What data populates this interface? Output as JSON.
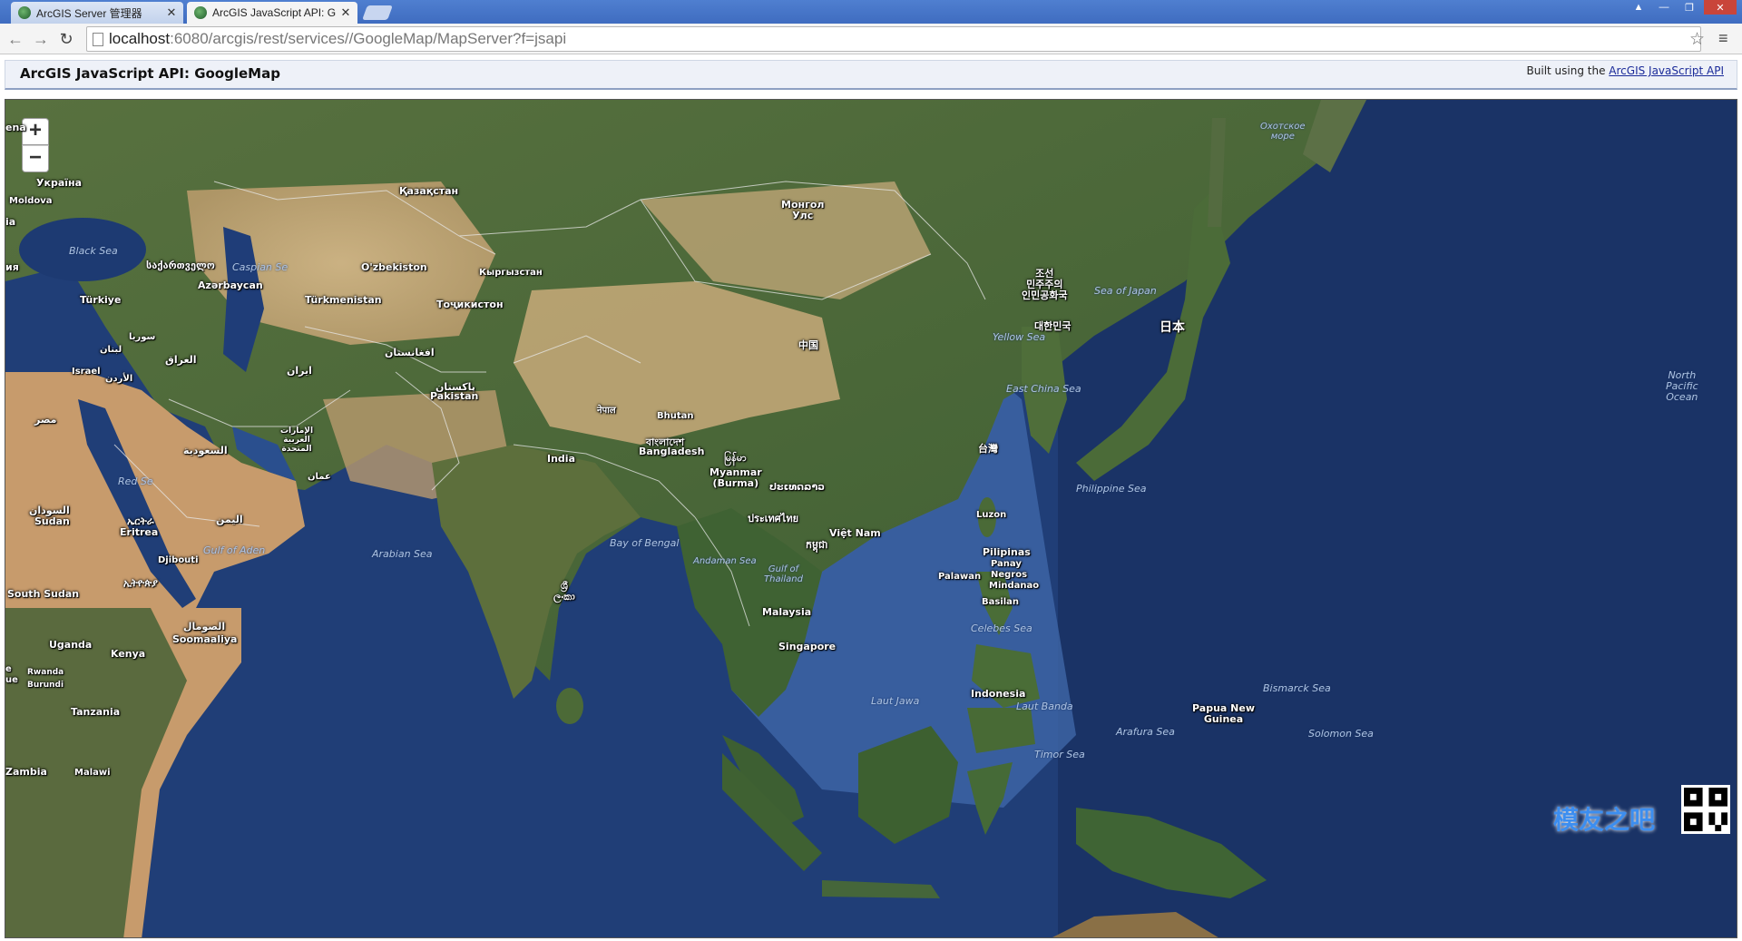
{
  "browser": {
    "tabs": [
      {
        "title": "ArcGIS Server 管理器",
        "active": false
      },
      {
        "title": "ArcGIS JavaScript API: G",
        "active": true
      }
    ],
    "address": {
      "host": "localhost",
      "path": ":6080/arcgis/rest/services//GoogleMap/MapServer?f=jsapi"
    },
    "window_controls": [
      "▲",
      "—",
      "❐",
      "✕"
    ]
  },
  "page": {
    "title": "ArcGIS JavaScript API: GoogleMap",
    "built_prefix": "Built using the",
    "built_link": "ArcGIS JavaScript API"
  },
  "map": {
    "zoom_in": "+",
    "zoom_out": "−",
    "labels": {
      "l_ena": "ena",
      "l_ukraina": "Україна",
      "l_moldova": "Moldova",
      "l_ia": "ia",
      "l_black_sea": "Black Sea",
      "l_sakartvelo": "საქართველო",
      "l_caspian": "Caspian Se",
      "l_azerbaycan": "Azərbaycan",
      "l_iya": "ия",
      "l_kazakhstan": "Қазақстан",
      "l_mongol": "Монгол\nУлс",
      "l_okhotsk": "Охотское\nморе",
      "l_uzbekiston": "O'zbekiston",
      "l_kyrgyz": "Кыргызстан",
      "l_turkmenistan": "Türkmenistan",
      "l_tajikistan": "Тоҷикистон",
      "l_turkiye": "Türkiye",
      "l_dprk": "조선\n민주주의\n인민공화국",
      "l_sea_japan": "Sea of Japan",
      "l_nihon": "日本",
      "l_korea": "대한민국",
      "l_yellow_sea": "Yellow Sea",
      "l_suriya": "سوريا",
      "l_lubnan": "لبنان",
      "l_israel": "Israel",
      "l_urdun": "الأردن",
      "l_iraq": "العراق",
      "l_iran": "ایران",
      "l_afghanistan": "افغانستان",
      "l_china": "中国",
      "l_pakistan_ar": "پاکستان",
      "l_pakistan": "Pakistan",
      "l_east_china_sea": "East China Sea",
      "l_north_pacific": "North\nPacific\nOcean",
      "l_misr": "مصر",
      "l_nepal": "नेपाल",
      "l_bhutan": "Bhutan",
      "l_uae": "الإمارات\nالعربية\nالمتحدة",
      "l_saudi": "السعودية",
      "l_bangladesh_bn": "বাংলাদেশ",
      "l_bangladesh": "Bangladesh",
      "l_india": "India",
      "l_taiwan": "台灣",
      "l_myanmar_my": "မြန်မာ",
      "l_myanmar": "Myanmar\n(Burma)",
      "l_lao": "ປະເທດລາວ",
      "l_oman": "عمان",
      "l_red_sea": "Red Se",
      "l_philippine_sea": "Philippine Sea",
      "l_sudan_ar": "السودان",
      "l_sudan": "Sudan",
      "l_eritrea_ar": "ኤርትራ",
      "l_eritrea": "Eritrea",
      "l_thai": "ประเทศไทย",
      "l_yemen": "اليمن",
      "l_luzon": "Luzon",
      "l_vietnam": "Việt Nam",
      "l_kampuchea": "កម្ពុជា",
      "l_bay_bengal": "Bay of Bengal",
      "l_gulf_aden": "Gulf of Aden",
      "l_arabian_sea": "Arabian Sea",
      "l_pilipinas": "Pilipinas",
      "l_djibouti": "Djibouti",
      "l_andaman": "Andaman Sea",
      "l_panay": "Panay",
      "l_gulf_thailand": "Gulf of\nThailand",
      "l_palawan": "Palawan",
      "l_negros": "Negros",
      "l_ethiopia": "ኢትዮጵያ",
      "l_mindanao": "Mindanao",
      "l_south_sudan": "South Sudan",
      "l_srilanka": "ශ්‍රී\nලංකා",
      "l_basilan": "Basilan",
      "l_malaysia": "Malaysia",
      "l_somal_ar": "الصومال",
      "l_soomaaliya": "Soomaaliya",
      "l_celebes": "Celebes Sea",
      "l_uganda": "Uganda",
      "l_singapore": "Singapore",
      "l_kenya": "Kenya",
      "l_e": "e",
      "l_rwanda": "Rwanda",
      "l_ue": "ue",
      "l_burundi": "Burundi",
      "l_bismarck": "Bismarck Sea",
      "l_indonesia": "Indonesia",
      "l_laut_jawa": "Laut Jawa",
      "l_laut_banda": "Laut Banda",
      "l_png": "Papua New\nGuinea",
      "l_tanzania": "Tanzania",
      "l_arafura": "Arafura Sea",
      "l_solomon": "Solomon Sea",
      "l_timor": "Timor Sea",
      "l_zambia": "Zambia",
      "l_malawi": "Malawi"
    },
    "watermark": "模友之吧",
    "colors": {
      "ocean": "#203e77",
      "deep_ocean": "#1a3366",
      "shelf": "#4a73b8",
      "land_green": "#4e6a3c",
      "desert": "#c9a979",
      "border": "#e6e6e6"
    }
  }
}
